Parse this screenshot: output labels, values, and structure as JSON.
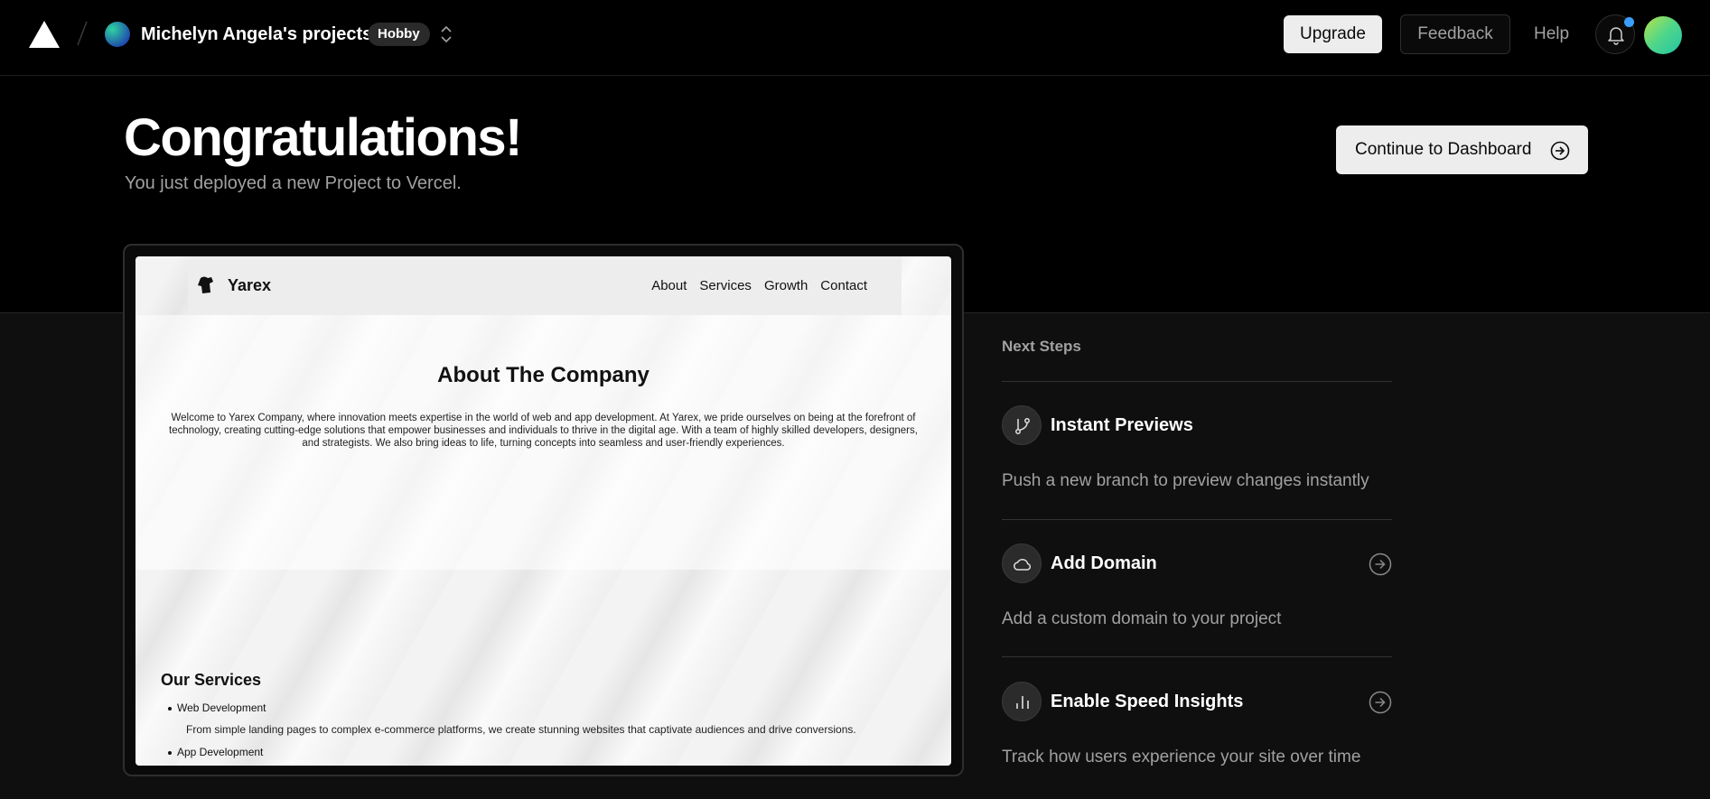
{
  "header": {
    "team_name": "Michelyn Angela's projects",
    "plan_badge": "Hobby",
    "upgrade_label": "Upgrade",
    "feedback_label": "Feedback",
    "help_label": "Help",
    "notification_dot_color": "#3b9eff"
  },
  "hero": {
    "title": "Congratulations!",
    "subtitle": "You just deployed a new Project to Vercel.",
    "continue_label": "Continue to Dashboard"
  },
  "preview": {
    "brand": "Yarex",
    "nav_links": [
      "About",
      "Services",
      "Growth",
      "Contact"
    ],
    "about_title": "About The Company",
    "about_text": "Welcome to Yarex Company, where innovation meets expertise in the world of web and app development. At Yarex, we pride ourselves on being at the forefront of technology, creating cutting-edge solutions that empower businesses and individuals to thrive in the digital age. With a team of highly skilled developers, designers, and strategists. We also bring ideas to life, turning concepts into seamless and user-friendly experiences.",
    "services_title": "Our Services",
    "services": [
      {
        "name": "Web Development",
        "desc": "From simple landing pages to complex e-commerce platforms, we create stunning websites that captivate audiences and drive conversions."
      },
      {
        "name": "App Development"
      }
    ]
  },
  "next_steps": {
    "heading": "Next Steps",
    "items": [
      {
        "icon": "git-branch-icon",
        "title": "Instant Previews",
        "desc": "Push a new branch to preview changes instantly"
      },
      {
        "icon": "cloud-icon",
        "title": "Add Domain",
        "desc": "Add a custom domain to your project"
      },
      {
        "icon": "bar-chart-icon",
        "title": "Enable Speed Insights",
        "desc": "Track how users experience your site over time"
      }
    ]
  }
}
